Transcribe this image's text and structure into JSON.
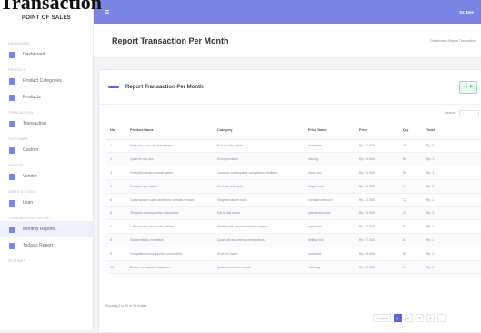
{
  "overlay_title": "Transaction",
  "app": {
    "brand": "POINT OF SALES",
    "user": "Dr. Dee"
  },
  "sidebar": {
    "items": [
      {
        "section": "DASHBOARD",
        "label": "Dashboard",
        "color": "#7b86e4",
        "name": "sidebar-item-dashboard"
      },
      {
        "section": "PRODUCT",
        "label": "Product Categories",
        "color": "#7b86e4",
        "name": "sidebar-item-product-categories"
      },
      {
        "section": "",
        "label": "Products",
        "color": "#7b86e4",
        "name": "sidebar-item-products"
      },
      {
        "section": "TRANSACTION",
        "label": "Transaction",
        "color": "#7b86e4",
        "name": "sidebar-item-transaction"
      },
      {
        "section": "CUSTOMER",
        "label": "Custom",
        "color": "#7b86e4",
        "name": "sidebar-item-custom"
      },
      {
        "section": "VENDOR",
        "label": "Vendor",
        "color": "#7b86e4",
        "name": "sidebar-item-vendor"
      },
      {
        "section": "DEBTS & LOANS",
        "label": "Loan",
        "color": "#7b86e4",
        "name": "sidebar-item-loan"
      },
      {
        "section": "TRANSACTIONS REPORT",
        "label": "Monthly Reports",
        "color": "#7b86e4",
        "name": "sidebar-item-monthly-reports",
        "active": true
      },
      {
        "section": "",
        "label": "Today's Report",
        "color": "#7b86e4",
        "name": "sidebar-item-todays-report"
      }
    ],
    "trailing_section": "SETTINGS"
  },
  "header": {
    "title": "Report Transaction Per Month",
    "breadcrumb": "Dashboard / Report Transaction"
  },
  "card": {
    "title": "Report Transaction Per Month",
    "filter_label": "▼ F",
    "search_label": "Search:"
  },
  "table": {
    "columns": [
      "No",
      "Product Name",
      "Category",
      "Price Name",
      "Price",
      "Qty",
      "Total"
    ],
    "rows": [
      [
        "1",
        "Hatit minus ipsum ut similique",
        "Eos ut iusto totam",
        "molestias",
        "Rp. 70.000",
        "48",
        "Rp. 3"
      ],
      [
        "2",
        "Quam in est quo",
        "Enim provident",
        "nisi.org",
        "Rp. 30.000",
        "56",
        "Rp. 1"
      ],
      [
        "3",
        "Excepturi neque beatae ipsam",
        "Cumque consequatur voluptatum similique",
        "fuad.com",
        "Rp. 30.000",
        "56",
        "Rp. 1"
      ],
      [
        "4",
        "Cumque quo rerum",
        "Ea iusto ut et quia",
        "hayes.com",
        "Rp. 46.000",
        "12",
        "Rp. 5"
      ],
      [
        "5",
        "Consequatur culpa architecto veritatis veniam",
        "Magnam labore nulla",
        "crooksmarie.com",
        "Rp. 23.000",
        "12",
        "Rp. 2"
      ],
      [
        "6",
        "Tempora consequuntur voluptatum",
        "Est ut nisi totam",
        "pfannerson.com",
        "Rp. 30.000",
        "12",
        "Rp. 3"
      ],
      [
        "7",
        "Laborum ab consecuitur labore",
        "Perferendis est praesentium saepen",
        "apple.info",
        "Rp. 40.000",
        "63",
        "Rp. 2"
      ],
      [
        "8",
        "Est architecto molestias",
        "Quam ab assumenda temporibus",
        "ketling.info",
        "Rp. 27.000",
        "63",
        "Rp. 1"
      ],
      [
        "9",
        "Voluptates consequuntur consectetur",
        "Sunt vel totam",
        "rosini.net",
        "Rp. 25.000",
        "63",
        "Rp. 2"
      ],
      [
        "10",
        "Beatae aut quasi voluptatum",
        "Quasi sunt harum totam",
        "nitra.org",
        "Rp. 30.000",
        "14",
        "Rp. 4"
      ]
    ]
  },
  "footer": {
    "info": "Showing 1 to 10 of 38 entries"
  },
  "pagination": {
    "prev": "Previous",
    "pages": [
      "1",
      "2",
      "3",
      "4"
    ],
    "next": "›"
  }
}
